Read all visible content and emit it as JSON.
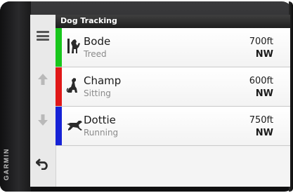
{
  "brand": "GARMIN",
  "header": {
    "title": "Dog Tracking"
  },
  "dogs": [
    {
      "name": "Bode",
      "status": "Treed",
      "distance": "700ft",
      "direction": "NW",
      "color": "#18c61c",
      "icon": "dog-treed-icon"
    },
    {
      "name": "Champ",
      "status": "Sitting",
      "distance": "600ft",
      "direction": "NW",
      "color": "#e01818",
      "icon": "dog-sitting-icon"
    },
    {
      "name": "Dottie",
      "status": "Running",
      "distance": "750ft",
      "direction": "NW",
      "color": "#1622d6",
      "icon": "dog-running-icon"
    }
  ],
  "sidebar": {
    "buttons": [
      {
        "icon": "menu-icon"
      },
      {
        "icon": "arrow-up-icon"
      },
      {
        "icon": "arrow-down-icon"
      },
      {
        "icon": "back-icon"
      }
    ]
  },
  "colors": {
    "header_bg": "#1f1f1f",
    "screen_bg": "#f4f4f4",
    "icon_gray": "#555555"
  }
}
